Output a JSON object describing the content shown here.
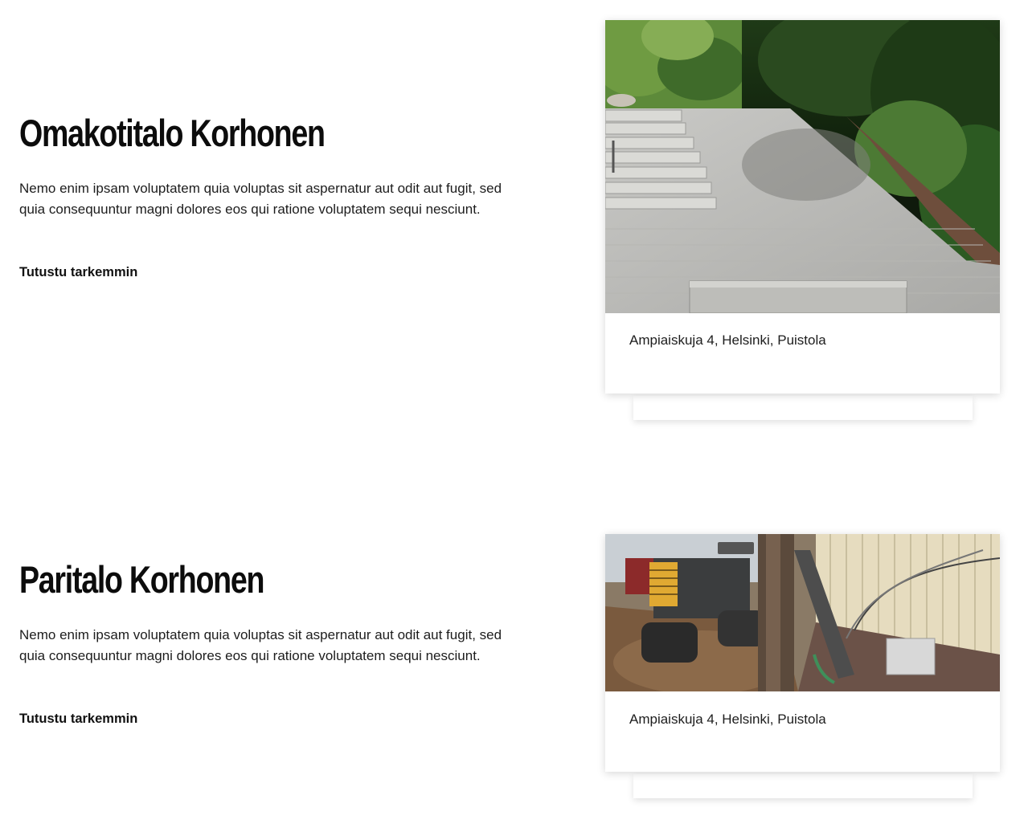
{
  "projects": [
    {
      "title": "Omakotitalo Korhonen",
      "description": "Nemo enim ipsam voluptatem quia voluptas sit aspernatur aut odit aut fugit, sed quia consequuntur magni dolores eos qui ratione voluptatem sequi nesciunt.",
      "link_label": "Tutustu tarkemmin",
      "address": "Ampiaiskuja 4, Helsinki, Puistola"
    },
    {
      "title": "Paritalo Korhonen",
      "description": "Nemo enim ipsam voluptatem quia voluptas sit aspernatur aut odit aut fugit, sed quia consequuntur magni dolores eos qui ratione voluptatem sequi nesciunt.",
      "link_label": "Tutustu tarkemmin",
      "address": "Ampiaiskuja 4, Helsinki, Puistola"
    }
  ]
}
